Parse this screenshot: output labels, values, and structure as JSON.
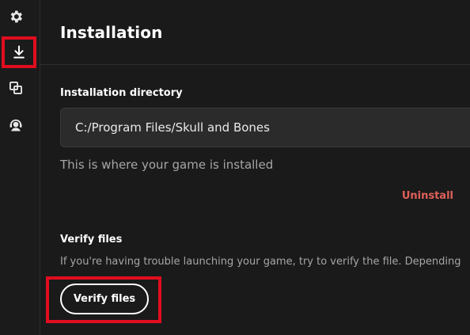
{
  "sidebar": {
    "items": [
      {
        "icon": "gear-icon",
        "active": false
      },
      {
        "icon": "download-icon",
        "active": true
      },
      {
        "icon": "copy-windows-icon",
        "active": false
      },
      {
        "icon": "support-agent-icon",
        "active": false
      }
    ]
  },
  "main": {
    "title": "Installation",
    "install_dir": {
      "label": "Installation directory",
      "value": "C:/Program Files/Skull and Bones",
      "helper": "This is where your game is installed"
    },
    "uninstall_label": "Uninstall",
    "verify": {
      "label": "Verify files",
      "description": "If you're having trouble launching your game, try to verify the file. Depending",
      "button_label": "Verify files"
    }
  },
  "colors": {
    "background": "#1a1a1a",
    "field": "#2b2b2b",
    "accent_danger": "#e0605a",
    "highlight": "#e10d1f"
  }
}
